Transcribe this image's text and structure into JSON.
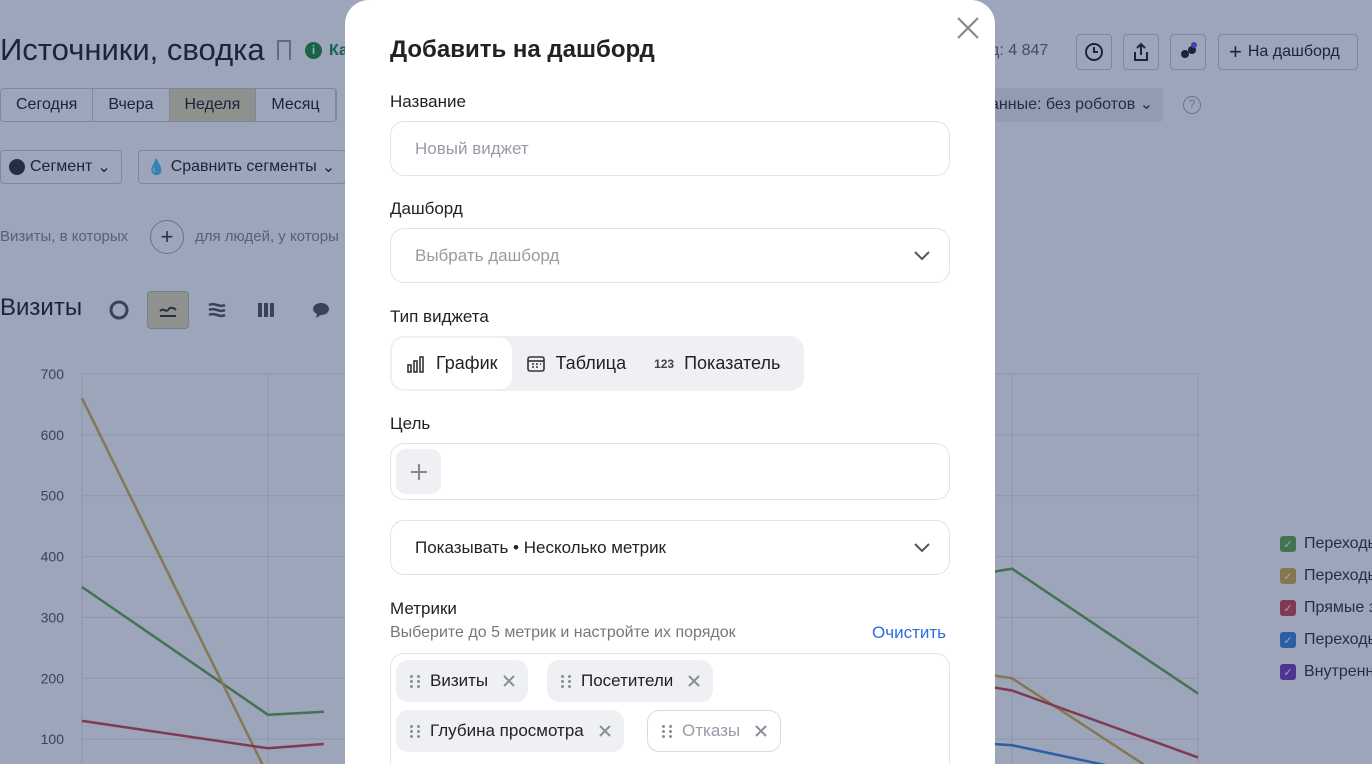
{
  "background": {
    "title": "Источники, сводка",
    "info_text": "Ка",
    "visitors_count": "д: 4 847",
    "to_dashboard_label": "На дашборд",
    "period_tabs": [
      "Сегодня",
      "Вчера",
      "Неделя",
      "Месяц"
    ],
    "active_period": "Неделя",
    "robots_filter": "анные: без роботов",
    "segment_label": "Сегмент",
    "compare_segments_label": "Сравнить сегменты",
    "filter_left_text": "Визиты, в которых",
    "filter_right_text": "для людей, у которы",
    "chart_title": "Визиты",
    "legend": [
      {
        "label": "Переходы",
        "color": "#6aa84f"
      },
      {
        "label": "Переходы",
        "color": "#d8b24a"
      },
      {
        "label": "Прямые з",
        "color": "#d0484a"
      },
      {
        "label": "Переходы",
        "color": "#3f86d9"
      },
      {
        "label": "Внутренн",
        "color": "#7b3fb8"
      }
    ]
  },
  "chart_data": {
    "type": "line",
    "yticks": [
      "700",
      "600",
      "500",
      "400",
      "300",
      "200",
      "100"
    ],
    "ylim": [
      0,
      700
    ],
    "series": [
      {
        "color": "#6aa84f",
        "points": [
          [
            0,
            350
          ],
          [
            1,
            140
          ],
          [
            1.3,
            145
          ]
        ]
      },
      {
        "color": "#d8b24a",
        "points": [
          [
            0,
            660
          ],
          [
            1,
            40
          ]
        ]
      },
      {
        "color": "#d0484a",
        "points": [
          [
            0,
            130
          ],
          [
            1,
            85
          ],
          [
            1.3,
            92
          ]
        ]
      },
      {
        "color": "#6aa84f",
        "points": [
          [
            4.9,
            375
          ],
          [
            5,
            380
          ],
          [
            6,
            175
          ]
        ]
      },
      {
        "color": "#d8b24a",
        "points": [
          [
            4.9,
            205
          ],
          [
            5,
            200
          ],
          [
            6,
            0
          ]
        ]
      },
      {
        "color": "#d0484a",
        "points": [
          [
            4.9,
            185
          ],
          [
            5,
            180
          ],
          [
            6,
            70
          ]
        ]
      },
      {
        "color": "#3f86d9",
        "points": [
          [
            4.9,
            92
          ],
          [
            5,
            90
          ],
          [
            6,
            25
          ]
        ]
      }
    ]
  },
  "modal": {
    "title": "Добавить на дашборд",
    "name_label": "Название",
    "name_placeholder": "Новый виджет",
    "dashboard_label": "Дашборд",
    "dashboard_placeholder": "Выбрать дашборд",
    "widget_type_label": "Тип виджета",
    "widget_types": [
      {
        "label": "График",
        "icon": "bar-chart-icon",
        "active": true
      },
      {
        "label": "Таблица",
        "icon": "table-icon",
        "active": false
      },
      {
        "label": "Показатель",
        "icon": "number-icon",
        "icon_text": "123",
        "active": false
      }
    ],
    "goal_label": "Цель",
    "show_value": "Показывать • Несколько метрик",
    "metrics_label": "Метрики",
    "metrics_hint": "Выберите до 5 метрик и настройте их порядок",
    "clear_label": "Очистить",
    "metrics": [
      {
        "label": "Визиты",
        "disabled": false
      },
      {
        "label": "Посетители",
        "disabled": false
      },
      {
        "label": "Глубина просмотра",
        "disabled": false
      },
      {
        "label": "Отказы",
        "disabled": true
      }
    ]
  }
}
